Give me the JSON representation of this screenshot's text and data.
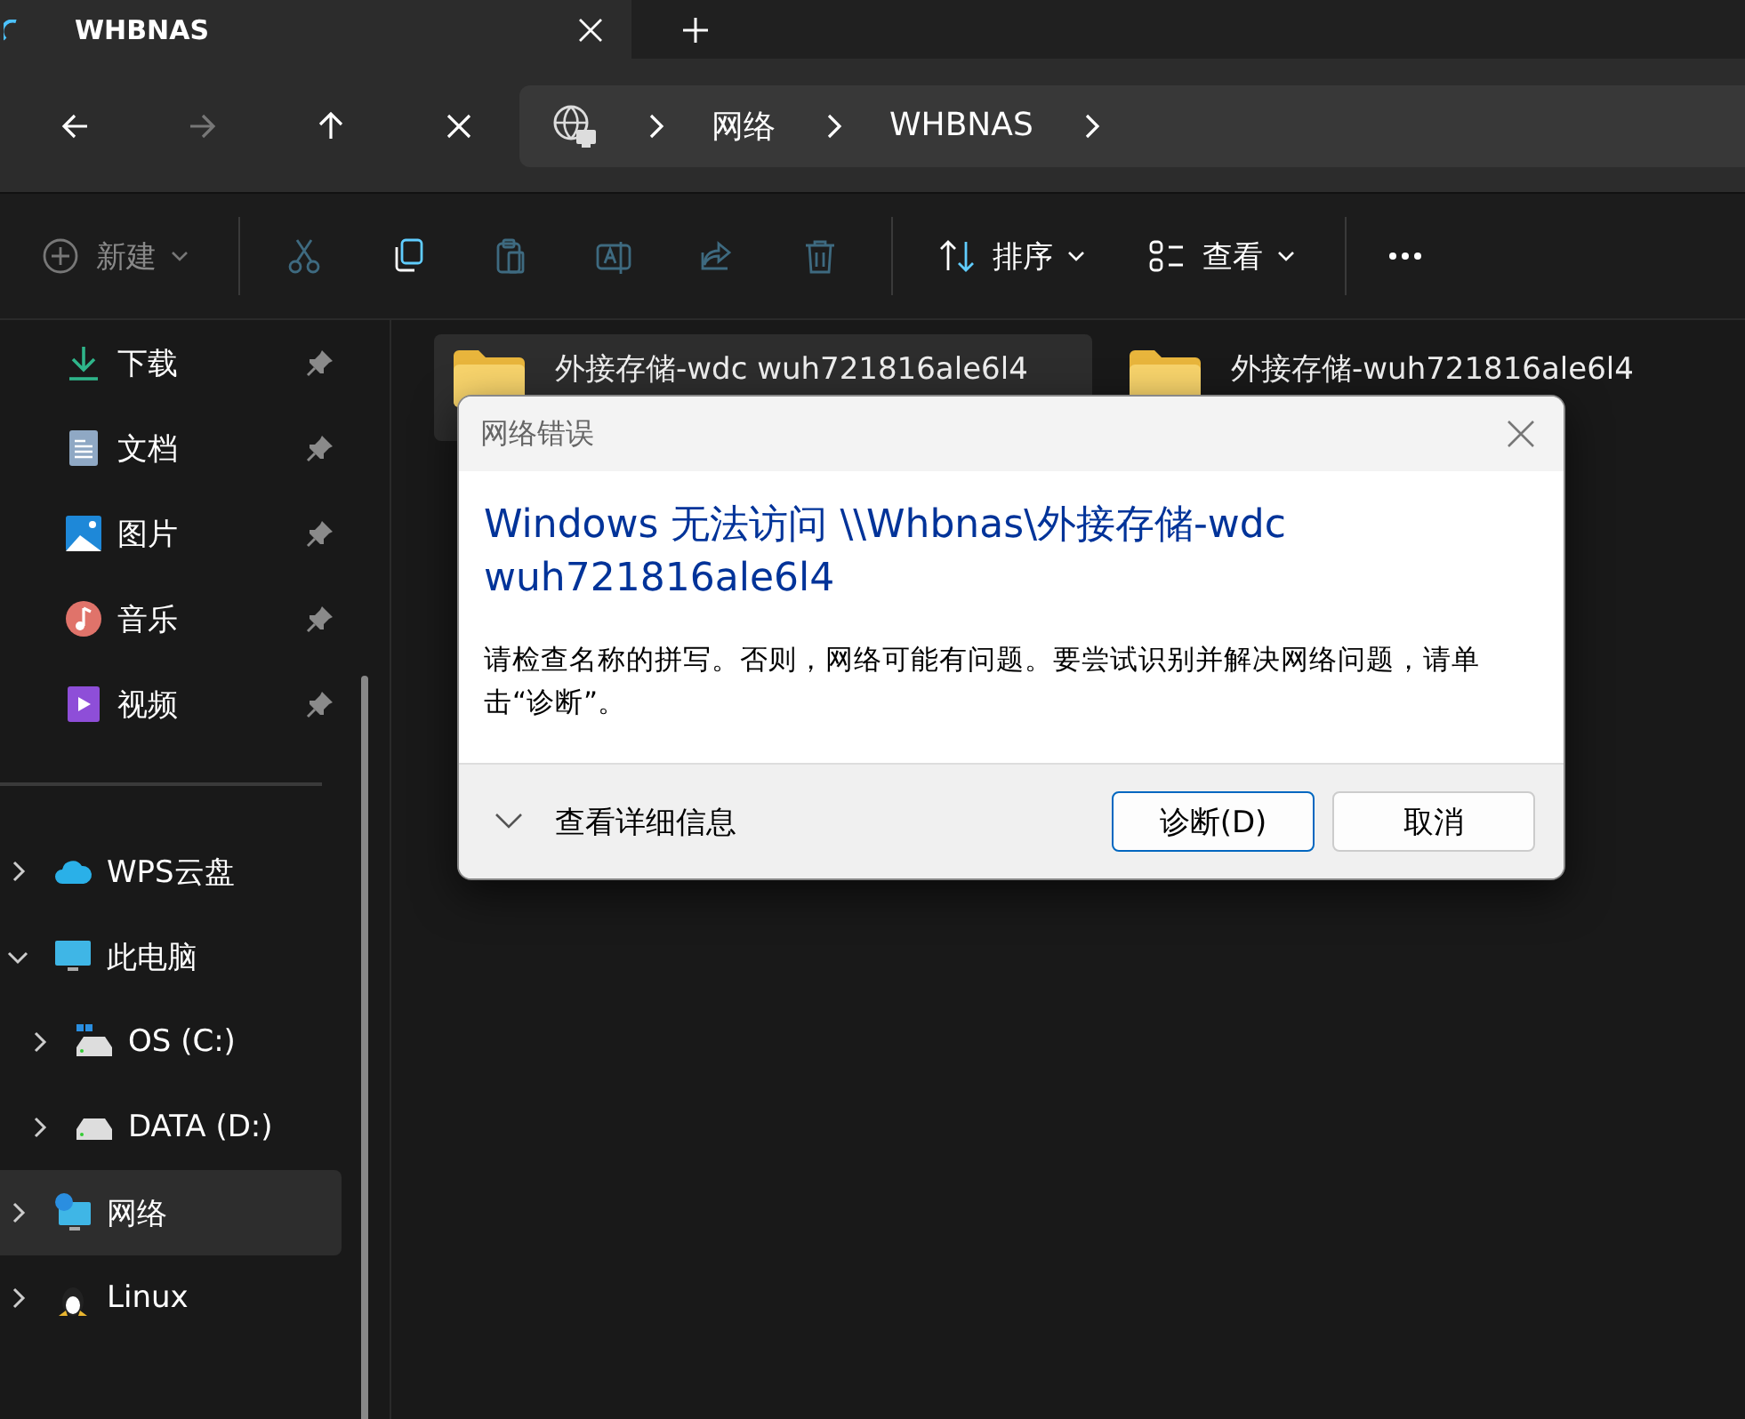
{
  "tab": {
    "title": "WHBNAS",
    "loading": true
  },
  "nav": [
    {
      "kind": "back",
      "disabled": false
    },
    {
      "kind": "forward",
      "disabled": true
    },
    {
      "kind": "up",
      "disabled": false
    },
    {
      "kind": "stop",
      "disabled": false
    }
  ],
  "breadcrumb": [
    "网络",
    "WHBNAS"
  ],
  "toolbar": [
    {
      "kind": "new",
      "label": "新建",
      "disabled": true
    },
    {
      "kind": "cut",
      "disabled": true
    },
    {
      "kind": "copy",
      "disabled": false
    },
    {
      "kind": "paste",
      "disabled": true
    },
    {
      "kind": "rename",
      "disabled": true
    },
    {
      "kind": "share",
      "disabled": true
    },
    {
      "kind": "delete",
      "disabled": true
    },
    {
      "kind": "sort",
      "label": "排序",
      "disabled": false
    },
    {
      "kind": "view",
      "label": "查看",
      "disabled": false
    },
    {
      "kind": "more",
      "disabled": false
    }
  ],
  "quick_access": [
    {
      "kind": "download",
      "label": "下载",
      "pinned": true
    },
    {
      "kind": "document",
      "label": "文档",
      "pinned": true
    },
    {
      "kind": "picture",
      "label": "图片",
      "pinned": true
    },
    {
      "kind": "music",
      "label": "音乐",
      "pinned": true
    },
    {
      "kind": "video",
      "label": "视频",
      "pinned": true
    }
  ],
  "tree": [
    {
      "kind": "cloud",
      "label": "WPS云盘",
      "expanded": false,
      "selected": false
    },
    {
      "kind": "pc",
      "label": "此电脑",
      "expanded": true,
      "selected": false,
      "children": [
        {
          "kind": "osdrive",
          "label": "OS (C:)",
          "expanded": false,
          "selected": false
        },
        {
          "kind": "drive",
          "label": "DATA (D:)",
          "expanded": false,
          "selected": false
        }
      ]
    },
    {
      "kind": "network",
      "label": "网络",
      "expanded": false,
      "selected": true
    },
    {
      "kind": "linux",
      "label": "Linux",
      "expanded": false,
      "selected": false
    }
  ],
  "files": [
    {
      "name": "外接存储-wdc wuh721816ale6l4",
      "selected": true
    },
    {
      "name": "外接存储-wuh721816ale6l4",
      "selected": false
    }
  ],
  "dialog": {
    "title": "网络错误",
    "heading": "Windows 无法访问 \\\\Whbnas\\外接存储-wdc wuh721816ale6l4",
    "message": "请检查名称的拼写。否则，网络可能有问题。要尝试识别并解决网络问题，请单击“诊断”。",
    "details": "查看详细信息",
    "details_expanded": false,
    "buttons": [
      {
        "label": "诊断(D)",
        "default": true
      },
      {
        "label": "取消",
        "default": false
      }
    ]
  }
}
